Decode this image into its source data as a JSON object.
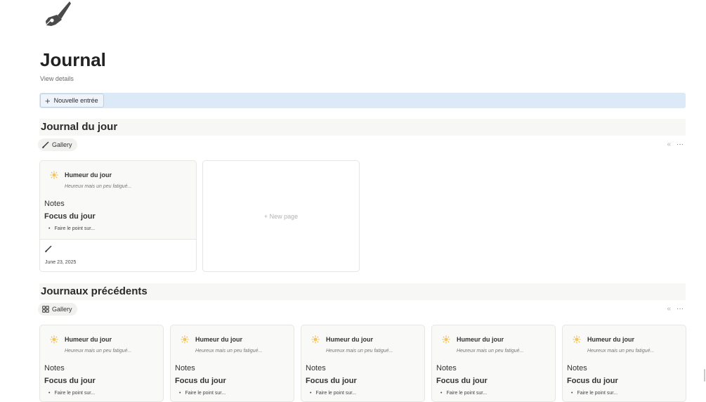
{
  "page": {
    "icon": "fountain-pen-icon",
    "title": "Journal",
    "view_details": "View details"
  },
  "callout": {
    "new_entry_label": "Nouvelle entrée",
    "color": "#dceaf7"
  },
  "today": {
    "heading": "Journal du jour",
    "view_tab": "Gallery",
    "view_tab_icon": "pen-icon",
    "card": {
      "mood_icon": "sun-icon",
      "mood_title": "Humeur du jour",
      "mood_sub": "Heureux mais un peu fatigué...",
      "notes": "Notes",
      "focus": "Focus du jour",
      "bullet": "Faire le point sur...",
      "footer_icon": "pen-icon",
      "date": "June 23, 2025"
    },
    "new_page": "+  New page"
  },
  "previous": {
    "heading": "Journaux précédents",
    "view_tab": "Gallery",
    "view_tab_icon": "gallery-grid-icon",
    "cards": [
      {
        "mood_title": "Humeur du jour",
        "mood_sub": "Heureux mais un peu fatigué...",
        "notes": "Notes",
        "focus": "Focus du jour",
        "bullet": "Faire le point sur..."
      },
      {
        "mood_title": "Humeur du jour",
        "mood_sub": "Heureux mais un peu fatigué...",
        "notes": "Notes",
        "focus": "Focus du jour",
        "bullet": "Faire le point sur..."
      },
      {
        "mood_title": "Humeur du jour",
        "mood_sub": "Heureux mais un peu fatigué...",
        "notes": "Notes",
        "focus": "Focus du jour",
        "bullet": "Faire le point sur..."
      },
      {
        "mood_title": "Humeur du jour",
        "mood_sub": "Heureux mais un peu fatigué...",
        "notes": "Notes",
        "focus": "Focus du jour",
        "bullet": "Faire le point sur..."
      },
      {
        "mood_title": "Humeur du jour",
        "mood_sub": "Heureux mais un peu fatigué...",
        "notes": "Notes",
        "focus": "Focus du jour",
        "bullet": "Faire le point sur..."
      }
    ]
  },
  "view_tools": {
    "collapse": "«",
    "more": "···"
  }
}
